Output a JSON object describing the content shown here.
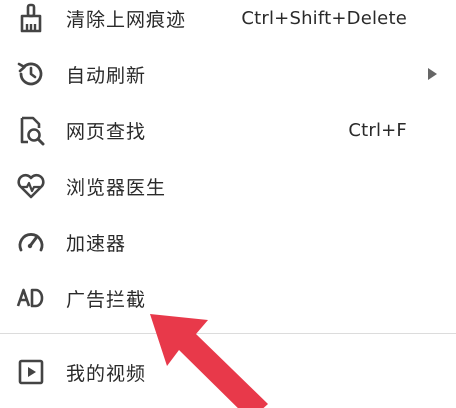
{
  "menu": {
    "items": [
      {
        "label": "清除上网痕迹",
        "shortcut": "Ctrl+Shift+Delete",
        "icon": "broom-icon"
      },
      {
        "label": "自动刷新",
        "shortcut": "",
        "icon": "auto-refresh-icon",
        "has_submenu": true
      },
      {
        "label": "网页查找",
        "shortcut": "Ctrl+F",
        "icon": "page-search-icon"
      },
      {
        "label": "浏览器医生",
        "shortcut": "",
        "icon": "heart-pulse-icon"
      },
      {
        "label": "加速器",
        "shortcut": "",
        "icon": "speedometer-icon"
      },
      {
        "label": "广告拦截",
        "shortcut": "",
        "icon": "ad-block-icon"
      },
      {
        "label": "我的视频",
        "shortcut": "",
        "icon": "video-play-icon"
      }
    ]
  },
  "colors": {
    "icon": "#444444",
    "text": "#2a2a2a",
    "divider": "#dcdcdc",
    "annotation_arrow": "#e8394a"
  }
}
